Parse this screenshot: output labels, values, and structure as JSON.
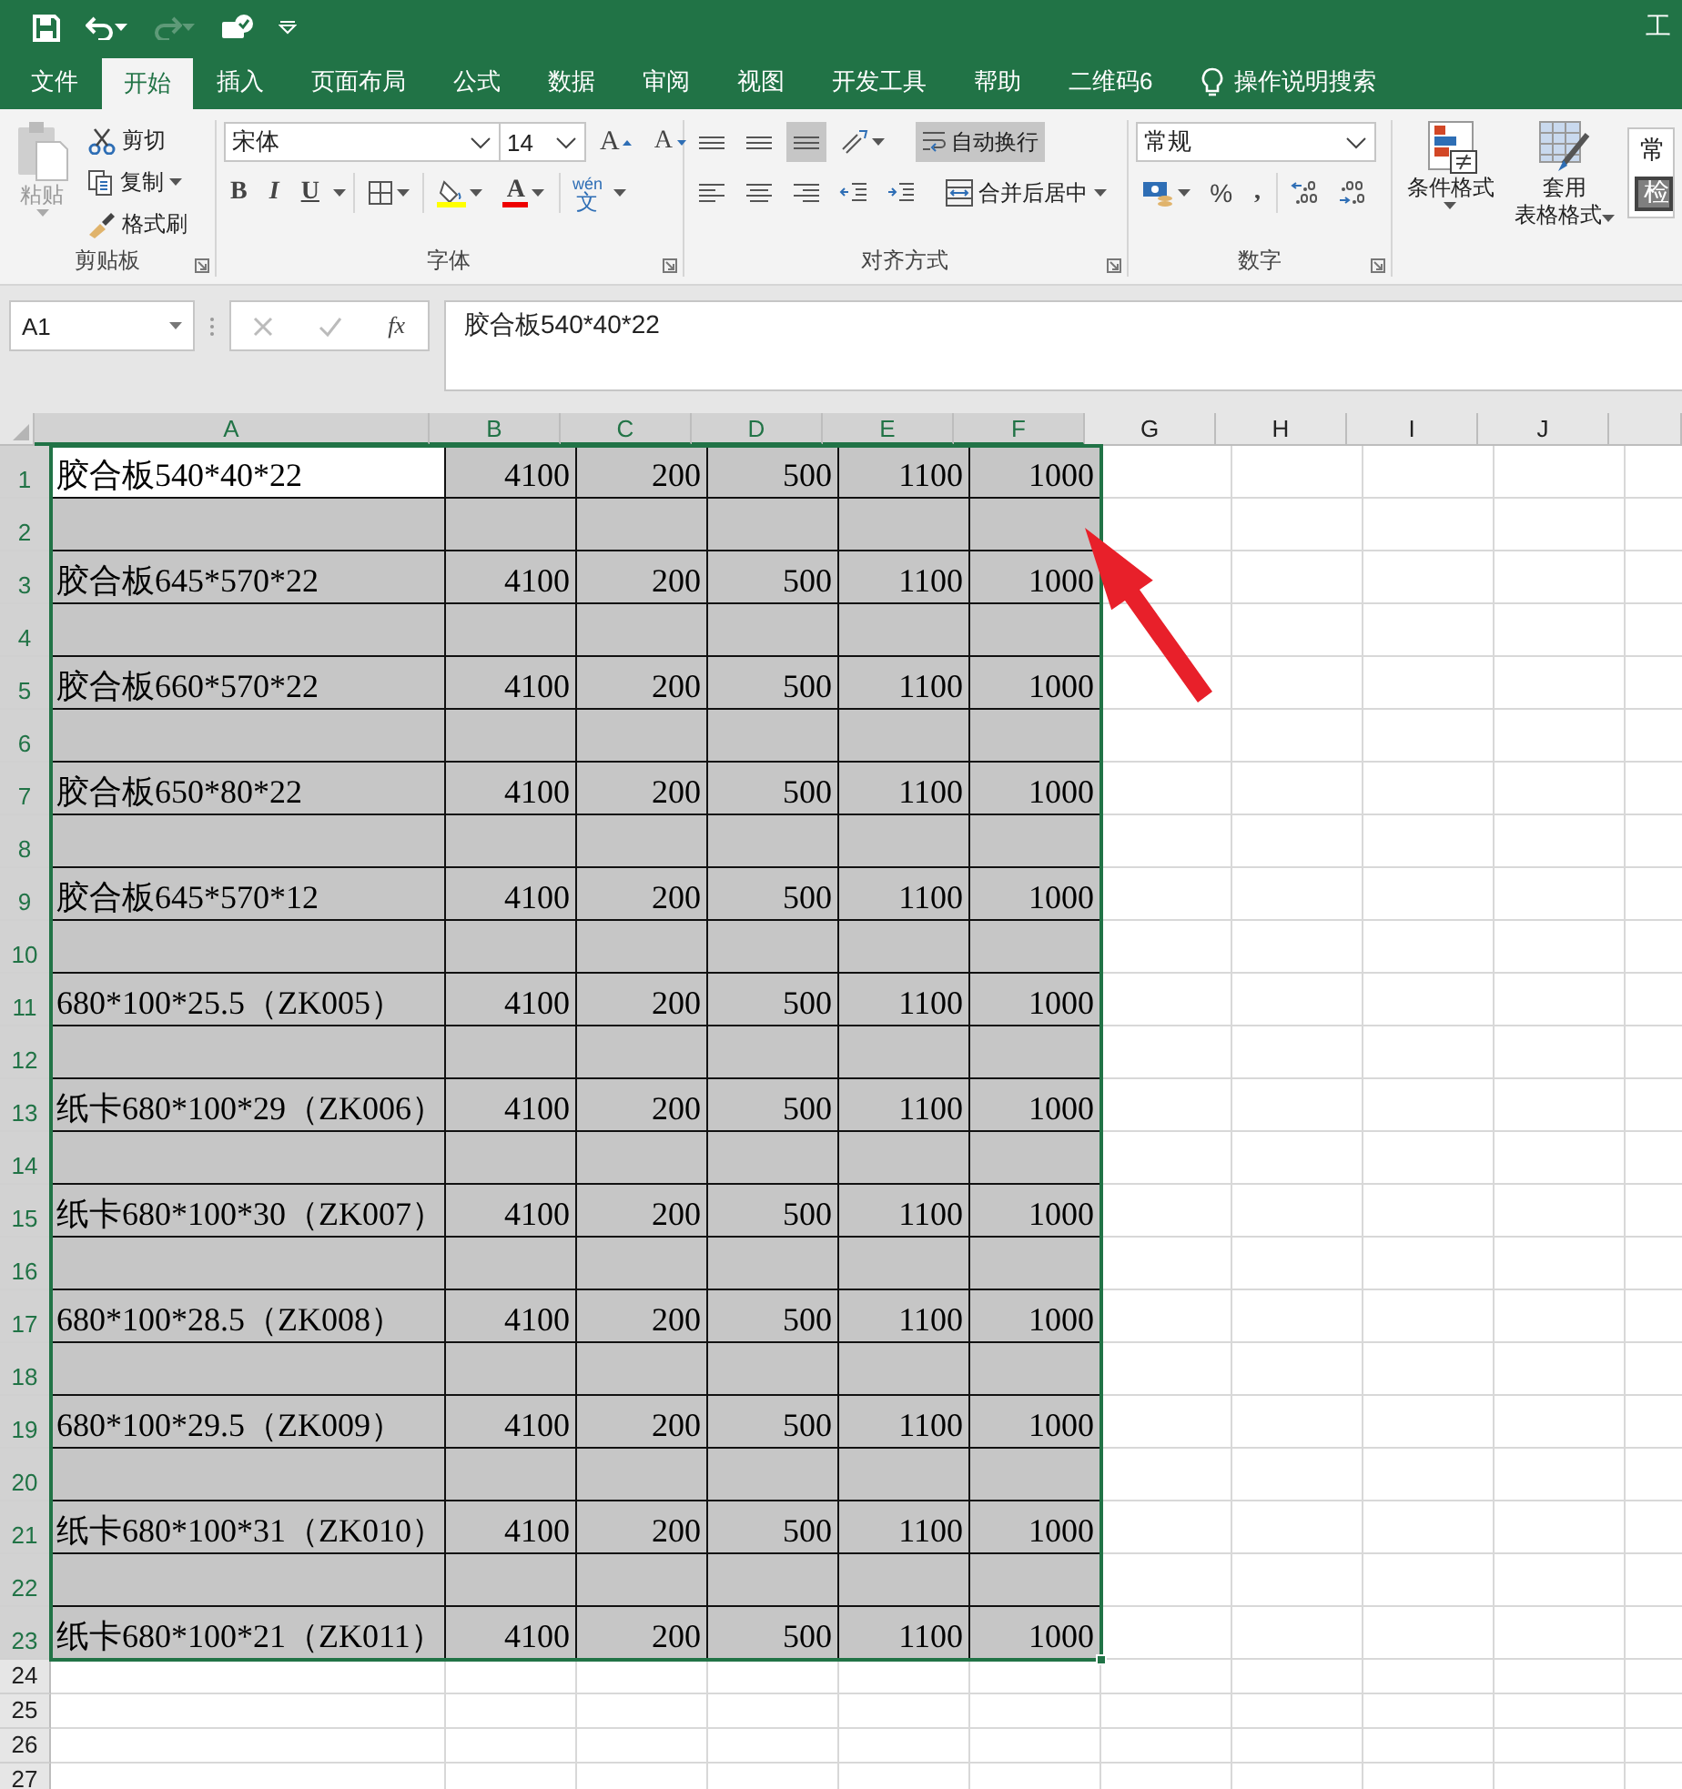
{
  "window": {
    "title": "工"
  },
  "quick_access": {
    "redo_disabled": true
  },
  "tabs": [
    {
      "label": "文件",
      "selected": false
    },
    {
      "label": "开始",
      "selected": true
    },
    {
      "label": "插入",
      "selected": false
    },
    {
      "label": "页面布局",
      "selected": false
    },
    {
      "label": "公式",
      "selected": false
    },
    {
      "label": "数据",
      "selected": false
    },
    {
      "label": "审阅",
      "selected": false
    },
    {
      "label": "视图",
      "selected": false
    },
    {
      "label": "开发工具",
      "selected": false
    },
    {
      "label": "帮助",
      "selected": false
    },
    {
      "label": "二维码6",
      "selected": false
    }
  ],
  "tell_me": "操作说明搜索",
  "ribbon": {
    "clipboard": {
      "label": "剪贴板",
      "paste": {
        "label": "粘贴",
        "disabled": true
      },
      "cut": "剪切",
      "copy": "复制",
      "format_painter": "格式刷"
    },
    "font": {
      "label": "字体",
      "font_name": "宋体",
      "font_size": "14",
      "grow": "A",
      "shrink": "A",
      "bold": "B",
      "italic": "I",
      "underline": "U",
      "font_color": "A",
      "pinyin": "wén",
      "pinyin_char": "文"
    },
    "alignment": {
      "label": "对齐方式",
      "align_bottom_on": true,
      "wrap_text": {
        "label": "自动换行",
        "on": true
      },
      "merge": "合并后居中"
    },
    "number": {
      "label": "数字",
      "format": "常规",
      "percent": "%",
      "comma": ","
    },
    "styles": {
      "conditional": "条件格式",
      "table_format": [
        "套用",
        "表格格式"
      ],
      "gallery": [
        "常",
        "检"
      ]
    }
  },
  "formula_bar": {
    "name_box": "A1",
    "fx": "fx",
    "formula": "胶合板540*40*22"
  },
  "sheet": {
    "columns": [
      {
        "label": "A",
        "selected": true
      },
      {
        "label": "B",
        "selected": true
      },
      {
        "label": "C",
        "selected": true
      },
      {
        "label": "D",
        "selected": true
      },
      {
        "label": "E",
        "selected": true
      },
      {
        "label": "F",
        "selected": true
      },
      {
        "label": "G",
        "selected": false
      },
      {
        "label": "H",
        "selected": false
      },
      {
        "label": "I",
        "selected": false
      },
      {
        "label": "J",
        "selected": false
      }
    ],
    "rows": [
      {
        "header": "1",
        "selected": true,
        "active_first": true,
        "cells": [
          "胶合板540*40*22",
          "4100",
          "200",
          "500",
          "1100",
          "1000"
        ]
      },
      {
        "header": "2",
        "selected": true
      },
      {
        "header": "3",
        "selected": true,
        "cells": [
          "胶合板645*570*22",
          "4100",
          "200",
          "500",
          "1100",
          "1000"
        ]
      },
      {
        "header": "4",
        "selected": true
      },
      {
        "header": "5",
        "selected": true,
        "cells": [
          "胶合板660*570*22",
          "4100",
          "200",
          "500",
          "1100",
          "1000"
        ]
      },
      {
        "header": "6",
        "selected": true
      },
      {
        "header": "7",
        "selected": true,
        "cells": [
          "胶合板650*80*22",
          "4100",
          "200",
          "500",
          "1100",
          "1000"
        ]
      },
      {
        "header": "8",
        "selected": true
      },
      {
        "header": "9",
        "selected": true,
        "cells": [
          "胶合板645*570*12",
          "4100",
          "200",
          "500",
          "1100",
          "1000"
        ]
      },
      {
        "header": "10",
        "selected": true
      },
      {
        "header": "11",
        "selected": true,
        "cells": [
          "680*100*25.5（ZK005）",
          "4100",
          "200",
          "500",
          "1100",
          "1000"
        ]
      },
      {
        "header": "12",
        "selected": true
      },
      {
        "header": "13",
        "selected": true,
        "cells": [
          "纸卡680*100*29（ZK006）",
          "4100",
          "200",
          "500",
          "1100",
          "1000"
        ]
      },
      {
        "header": "14",
        "selected": true
      },
      {
        "header": "15",
        "selected": true,
        "cells": [
          "纸卡680*100*30（ZK007）",
          "4100",
          "200",
          "500",
          "1100",
          "1000"
        ]
      },
      {
        "header": "16",
        "selected": true
      },
      {
        "header": "17",
        "selected": true,
        "cells": [
          "680*100*28.5（ZK008）",
          "4100",
          "200",
          "500",
          "1100",
          "1000"
        ]
      },
      {
        "header": "18",
        "selected": true
      },
      {
        "header": "19",
        "selected": true,
        "cells": [
          "680*100*29.5（ZK009）",
          "4100",
          "200",
          "500",
          "1100",
          "1000"
        ]
      },
      {
        "header": "20",
        "selected": true
      },
      {
        "header": "21",
        "selected": true,
        "cells": [
          "纸卡680*100*31（ZK010）",
          "4100",
          "200",
          "500",
          "1100",
          "1000"
        ]
      },
      {
        "header": "22",
        "selected": true
      },
      {
        "header": "23",
        "selected": true,
        "cells": [
          "纸卡680*100*21（ZK011）",
          "4100",
          "200",
          "500",
          "1100",
          "1000"
        ]
      },
      {
        "header": "24",
        "selected": false
      },
      {
        "header": "25",
        "selected": false
      },
      {
        "header": "26",
        "selected": false
      },
      {
        "header": "27",
        "selected": false
      }
    ]
  }
}
